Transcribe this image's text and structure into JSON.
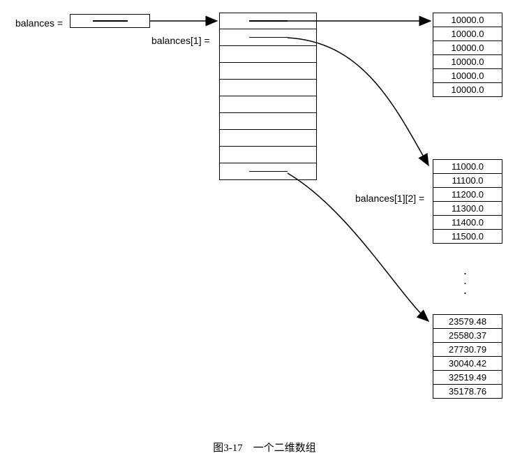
{
  "labels": {
    "balances": "balances =",
    "balances1": "balances[1] =",
    "balances12": "balances[1][2] ="
  },
  "array1": [
    "10000.0",
    "10000.0",
    "10000.0",
    "10000.0",
    "10000.0",
    "10000.0"
  ],
  "array2": [
    "11000.0",
    "11100.0",
    "11200.0",
    "11300.0",
    "11400.0",
    "11500.0"
  ],
  "array3": [
    "23579.48",
    "25580.37",
    "27730.79",
    "30040.42",
    "32519.49",
    "35178.76"
  ],
  "caption": "图3-17　一个二维数组",
  "chart_data": {
    "type": "diagram",
    "description": "Two-dimensional array (array of arrays) memory layout illustration",
    "root_ref": "balances",
    "middle_array_length": 10,
    "example_index_label": "balances[1]",
    "element_label": "balances[1][2]",
    "element_value": "11200.0",
    "sub_arrays": [
      {
        "index": 0,
        "values": [
          10000.0,
          10000.0,
          10000.0,
          10000.0,
          10000.0,
          10000.0
        ]
      },
      {
        "index": 1,
        "values": [
          11000.0,
          11100.0,
          11200.0,
          11300.0,
          11400.0,
          11500.0
        ]
      },
      {
        "index": "…",
        "values": []
      },
      {
        "index": 9,
        "values": [
          23579.48,
          25580.37,
          27730.79,
          30040.42,
          32519.49,
          35178.76
        ]
      }
    ],
    "caption": "图3-17 一个二维数组"
  }
}
